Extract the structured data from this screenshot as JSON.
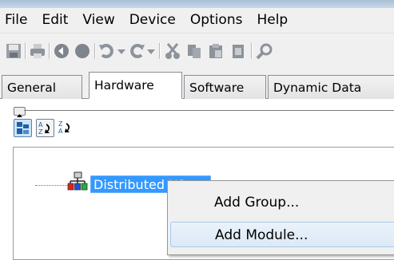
{
  "menubar": {
    "items": [
      "File",
      "Edit",
      "View",
      "Device",
      "Options",
      "Help"
    ]
  },
  "toolbar": {
    "icons": [
      "save-icon",
      "print-icon",
      "back-icon",
      "record-icon",
      "undo-icon",
      "redo-icon",
      "cut-icon",
      "copy-icon",
      "paste-icon",
      "delete-icon",
      "search-icon"
    ]
  },
  "tabs": [
    "General",
    "Hardware",
    "Software",
    "Dynamic Data"
  ],
  "active_tab": "Hardware",
  "tree": {
    "node_label": "Distributed I/O"
  },
  "context_menu": {
    "items": [
      "Add Group...",
      "Add Module..."
    ],
    "hovered": "Add Module..."
  },
  "colors": {
    "selection": "#3399ff",
    "chrome": "#f0f0f0",
    "hover": "#dce9f7"
  }
}
